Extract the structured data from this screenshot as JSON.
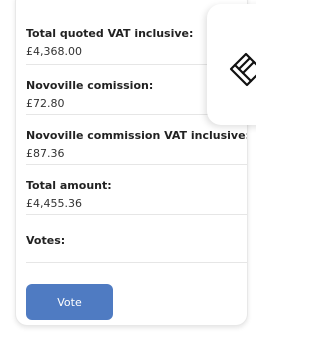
{
  "summary": {
    "total_quoted_label": "Total quoted VAT inclusive:",
    "total_quoted_value": "£4,368.00",
    "commission_label": "Novoville comission:",
    "commission_value": "£72.80",
    "commission_vat_label": "Novoville commission VAT inclusive:",
    "commission_vat_value": "£87.36",
    "total_amount_label": "Total amount:",
    "total_amount_value": "£4,455.36",
    "votes_label": "Votes:"
  },
  "actions": {
    "vote_label": "Vote"
  },
  "icons": {
    "floating_icon": "hand-icon"
  },
  "colors": {
    "accent": "#4f7bc2"
  }
}
